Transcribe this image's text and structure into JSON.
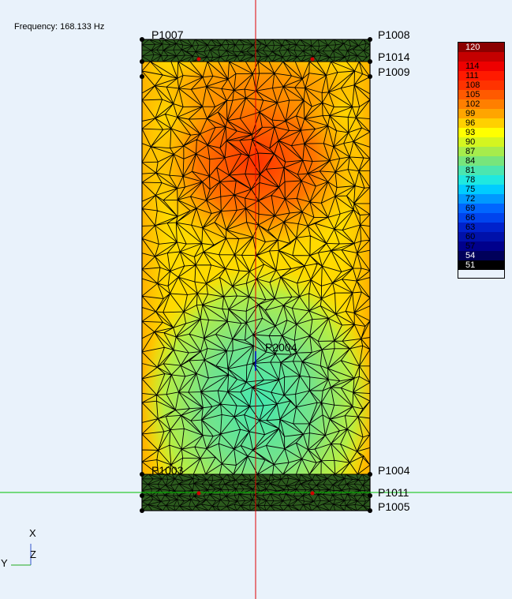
{
  "header": {
    "frequency_label": "Frequency: 168.133 Hz"
  },
  "points": [
    {
      "id": "p1007",
      "label": "P1007"
    },
    {
      "id": "p1008",
      "label": "P1008"
    },
    {
      "id": "p1014",
      "label": "P1014"
    },
    {
      "id": "p1009",
      "label": "P1009"
    },
    {
      "id": "p2004",
      "label": "P2004"
    },
    {
      "id": "p1003",
      "label": "P1003"
    },
    {
      "id": "p1004",
      "label": "P1004"
    },
    {
      "id": "p1011",
      "label": "P1011"
    },
    {
      "id": "p1005",
      "label": "P1005"
    }
  ],
  "axes": {
    "x": "X",
    "y": "Y",
    "z": "Z"
  },
  "legend": {
    "values": [
      "120",
      "",
      "114",
      "111",
      "108",
      "105",
      "102",
      "99",
      "96",
      "93",
      "90",
      "87",
      "84",
      "81",
      "78",
      "75",
      "72",
      "69",
      "66",
      "63",
      "60",
      "57",
      "54",
      "51"
    ],
    "colors": [
      "#8b0000",
      "#c40000",
      "#ee0000",
      "#ff1a00",
      "#ff3300",
      "#ff5a00",
      "#ff7f00",
      "#ffa500",
      "#ffd000",
      "#ffff00",
      "#d4f520",
      "#a6ec4c",
      "#77e57c",
      "#4be6b0",
      "#1fe8e0",
      "#00ccff",
      "#0099ff",
      "#0066ff",
      "#0044ee",
      "#0022cc",
      "#0011aa",
      "#00008c",
      "#00005a",
      "#000000"
    ]
  },
  "colors": {
    "mesh": "#000000",
    "band": "#2c5a1e",
    "hline": "#00c000",
    "vline": "#e00000",
    "z_axis": "#0000cc"
  }
}
